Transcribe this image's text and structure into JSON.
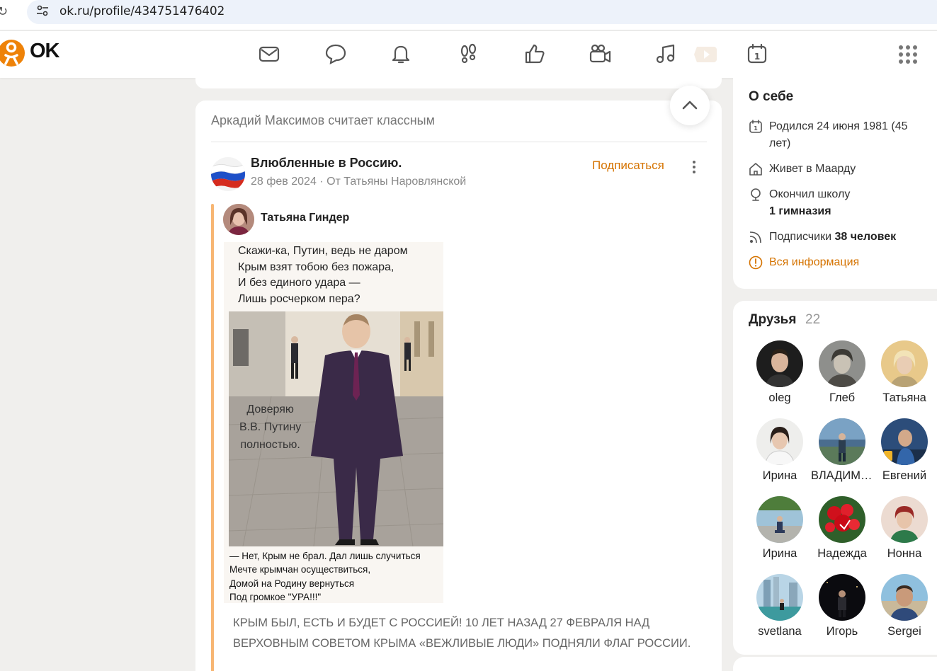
{
  "browser": {
    "url": "ok.ru/profile/434751476402"
  },
  "header": {
    "logo_text": "OK",
    "brand_color": "#ee8208",
    "nav_icons": [
      "mail-icon",
      "chat-icon",
      "bell-icon",
      "footprints-icon",
      "like-icon",
      "video-camera-icon",
      "music-icon",
      "play-icon",
      "calendar-icon"
    ]
  },
  "feed": {
    "liked_by": "Аркадий Максимов считает классным",
    "post": {
      "group_name": "Влюбленные в Россию.",
      "date": "28 фев 2024",
      "from_text": "От Татьяны Наровлянской",
      "subscribe_label": "Подписаться",
      "author_name": "Татьяна Гиндер",
      "image_poem_top": "Скажи-ка, Путин, ведь не даром\nКрым взят тобою  без пожара,\nИ без единого удара —\nЛишь росчерком пера?",
      "image_caption": "Доверяю\nВ.В. Путину\nполностью.",
      "image_poem_bottom": "— Нет, Крым не брал. Дал лишь случиться\n  Мечте крымчан осуществиться,\n  Домой на Родину вернуться\n  Под громкое \"УРА!!!\"",
      "text": "КРЫМ БЫЛ, ЕСТЬ И БУДЕТ С РОССИЕЙ! 10 ЛЕТ НАЗАД 27 ФЕВРАЛЯ  НАД ВЕРХОВНЫМ СОВЕТОМ КРЫМА «ВЕЖЛИВЫЕ ЛЮДИ» ПОДНЯЛИ ФЛАГ РОССИИ."
    }
  },
  "about": {
    "title": "О себе",
    "born": "Родился 24 июня 1981 (45 лет)",
    "lives": "Живет в Маарду",
    "school_label": "Окончил школу",
    "school_name": "1 гимназия",
    "followers_label": "Подписчики",
    "followers_count": "38 человек",
    "all_info_link": "Вся информация"
  },
  "friends": {
    "title": "Друзья",
    "count": "22",
    "items": [
      {
        "name": "oleg"
      },
      {
        "name": "Глеб"
      },
      {
        "name": "Татьяна"
      },
      {
        "name": "Ирина"
      },
      {
        "name": "ВЛАДИМИР"
      },
      {
        "name": "Евгений"
      },
      {
        "name": "Ирина"
      },
      {
        "name": "Надежда"
      },
      {
        "name": "Нонна"
      },
      {
        "name": "svetlana"
      },
      {
        "name": "Игорь"
      },
      {
        "name": "Sergei"
      }
    ]
  }
}
